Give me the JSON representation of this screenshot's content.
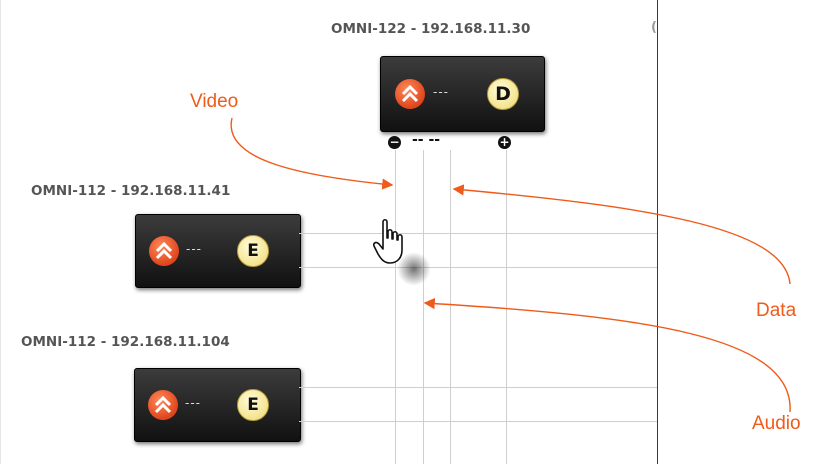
{
  "nodes": [
    {
      "title": "OMNI-122 - 192.168.11.30",
      "badge": "D",
      "dots": "---"
    },
    {
      "title": "OMNI-112 - 192.168.11.41",
      "badge": "E",
      "dots": "---"
    },
    {
      "title": "OMNI-112 - 192.168.11.104",
      "badge": "E",
      "dots": "---"
    }
  ],
  "controls": {
    "zoom_out": "−",
    "zoom_in": "+",
    "dashes": "-- --"
  },
  "callouts": {
    "video": "Video",
    "data": "Data",
    "audio": "Audio"
  },
  "colors": {
    "callout": "#f05a1a",
    "node_bg": "#1e1e1e",
    "badge": "#f6e78f",
    "source_icon": "#ef5a28"
  },
  "icons": {
    "source": "omni-source-icon",
    "cursor": "hand-pointer-icon"
  }
}
